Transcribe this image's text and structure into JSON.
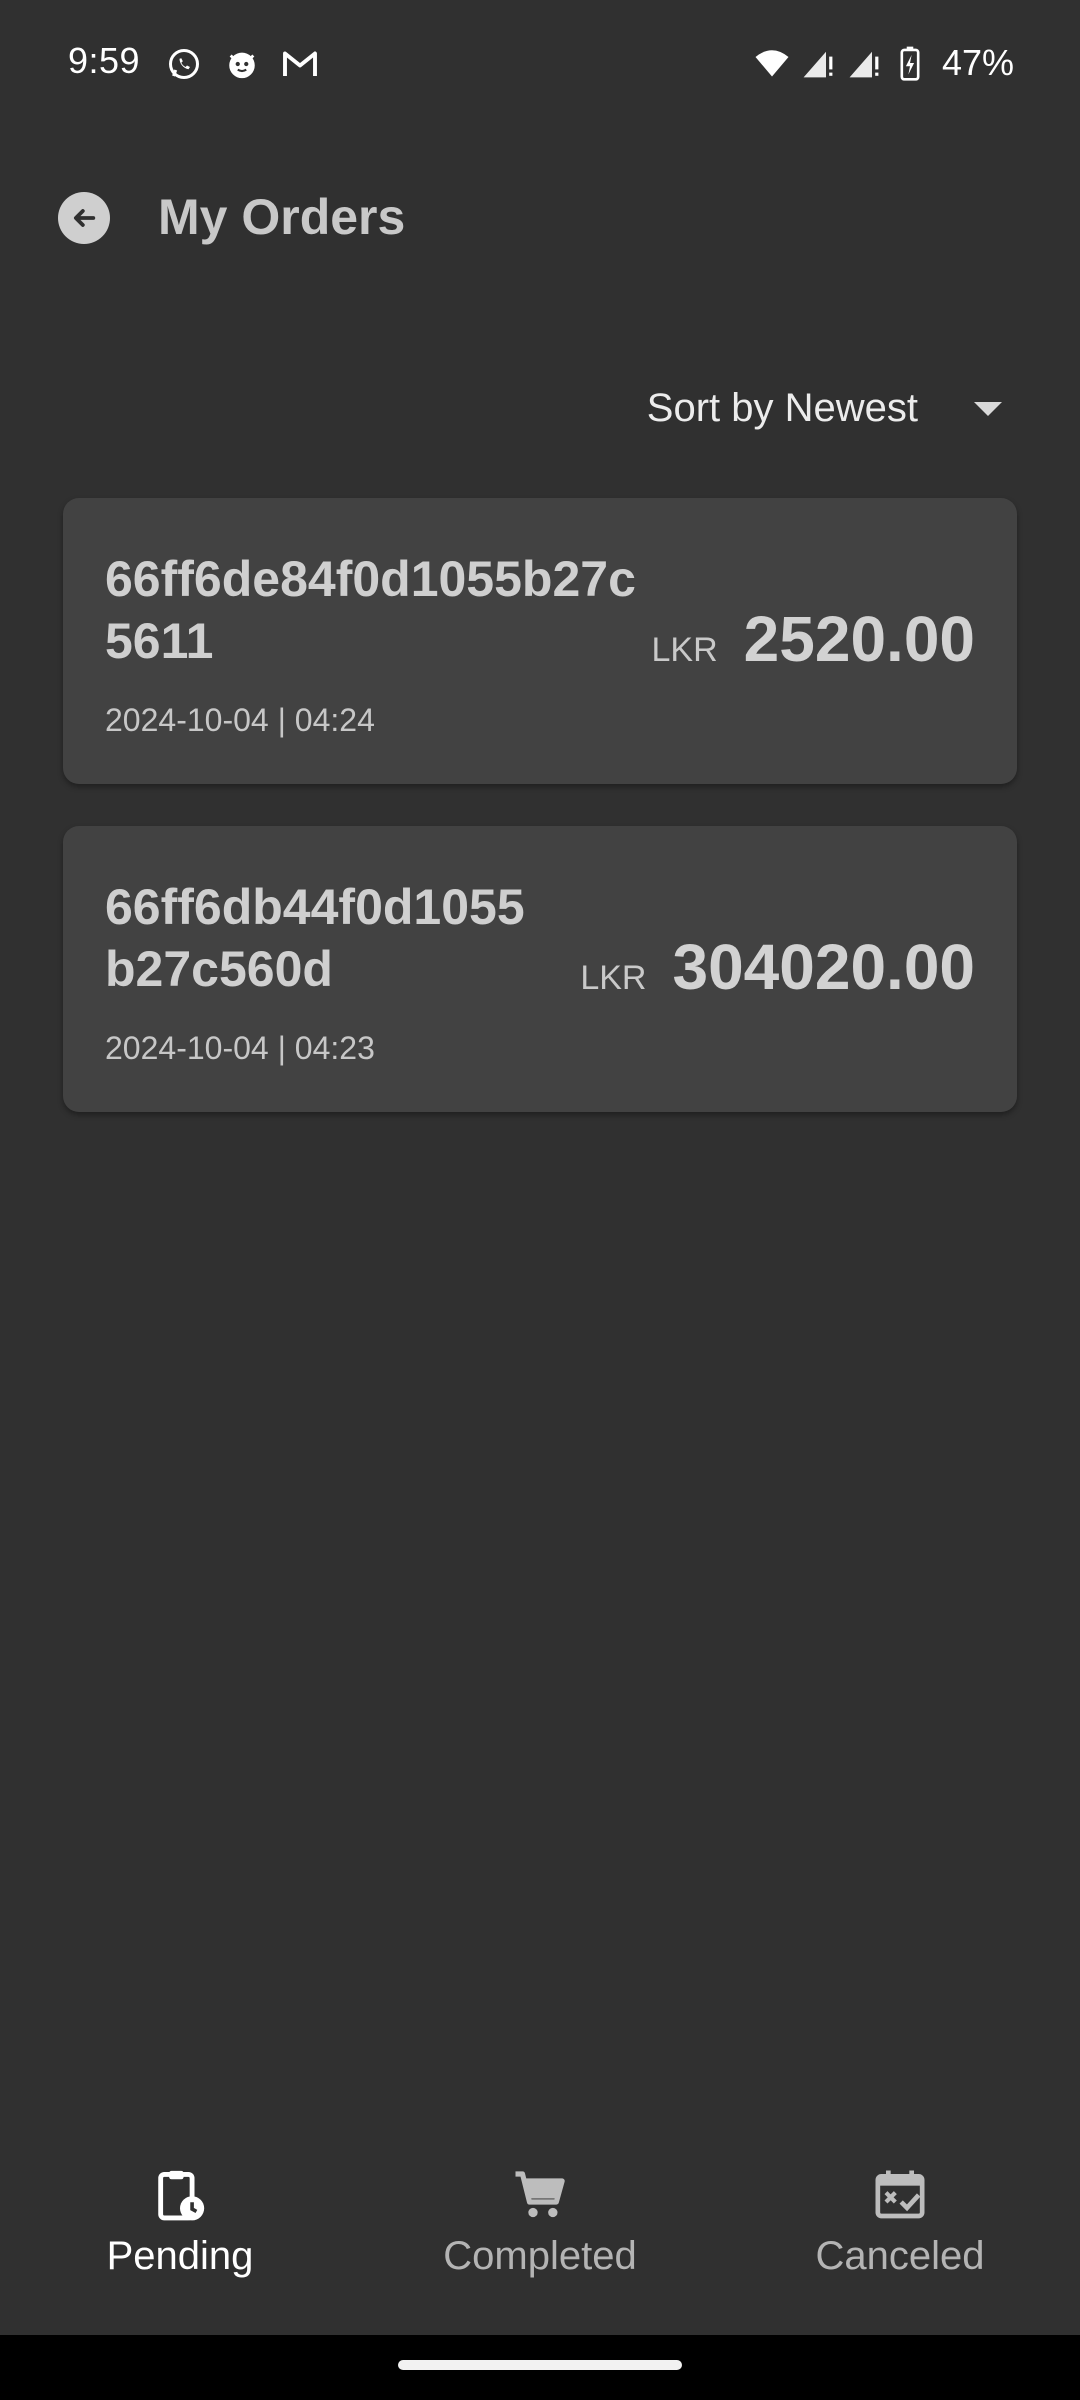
{
  "status_bar": {
    "time": "9:59",
    "left_icons": [
      "whatsapp-icon",
      "cat-app-icon",
      "gmail-icon"
    ],
    "right_icons": [
      "wifi-icon",
      "signal-icon",
      "signal-icon",
      "battery-charging-icon"
    ],
    "battery_percent": "47%"
  },
  "header": {
    "title": "My Orders"
  },
  "sort": {
    "label": "Sort by Newest"
  },
  "orders": [
    {
      "id": "66ff6de84f0d1055b27c5611",
      "date": "2024-10-04 | 04:24",
      "currency": "LKR",
      "amount": "2520.00"
    },
    {
      "id": "66ff6db44f0d1055b27c560d",
      "date": "2024-10-04 | 04:23",
      "currency": "LKR",
      "amount": "304020.00"
    }
  ],
  "bottom_nav": {
    "items": [
      {
        "label": "Pending",
        "icon": "clipboard-clock-icon",
        "active": true
      },
      {
        "label": "Completed",
        "icon": "cart-icon",
        "active": false
      },
      {
        "label": "Canceled",
        "icon": "calendar-x-icon",
        "active": false
      }
    ]
  },
  "colors": {
    "background": "#303030",
    "card": "#424242",
    "text_primary": "#cfcfcf",
    "nav_active": "#ffffff",
    "nav_inactive": "#b4b4b4"
  }
}
